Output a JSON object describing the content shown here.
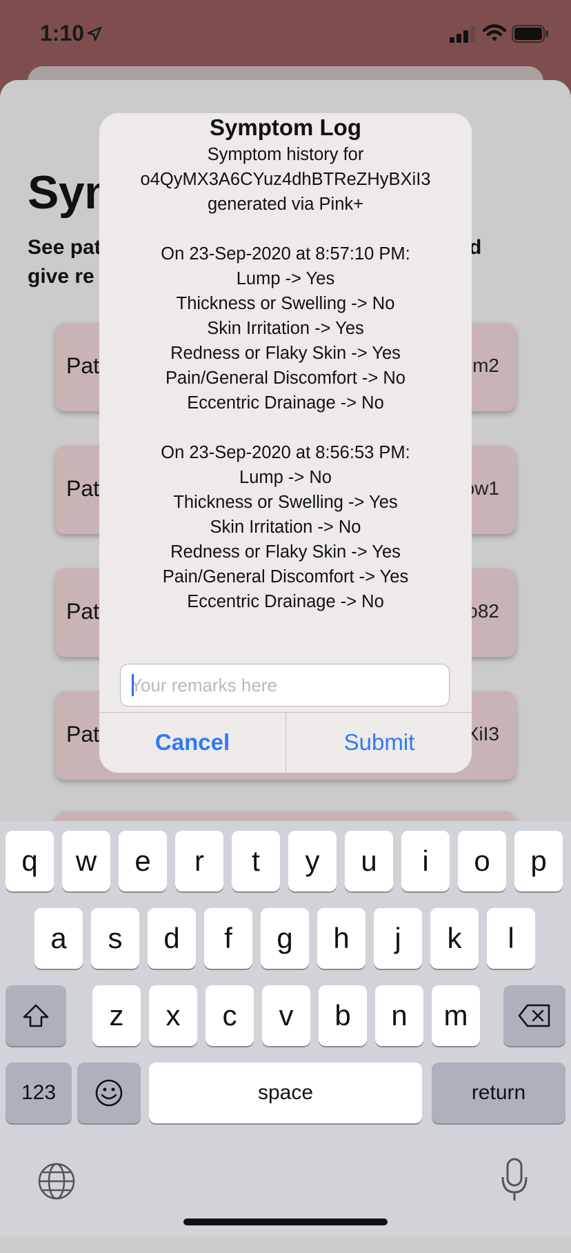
{
  "status_bar": {
    "time": "1:10"
  },
  "page": {
    "title": "Sym",
    "subtitle_line1": "See pat",
    "subtitle_line1_right": "d",
    "subtitle_line2": "give re"
  },
  "cards": [
    {
      "left": "Pat",
      "right": "m2"
    },
    {
      "left": "Pat",
      "right": "ow1"
    },
    {
      "left": "Pat",
      "right": "o82"
    },
    {
      "left": "Pat",
      "right": "XiI3"
    }
  ],
  "alert": {
    "title": "Symptom Log",
    "message_lines": [
      "Symptom history for",
      "o4QyMX3A6CYuz4dhBTReZHyBXiI3",
      "generated via Pink+",
      "",
      "On 23-Sep-2020 at 8:57:10 PM:",
      "Lump -> Yes",
      "Thickness or Swelling -> No",
      "Skin Irritation -> Yes",
      "Redness or Flaky Skin -> Yes",
      "Pain/General Discomfort -> No",
      "Eccentric Drainage -> No",
      "",
      "On 23-Sep-2020 at 8:56:53 PM:",
      "Lump -> No",
      "Thickness or Swelling -> Yes",
      "Skin Irritation -> No",
      "Redness or Flaky Skin -> Yes",
      "Pain/General Discomfort -> Yes",
      "Eccentric Drainage -> No"
    ],
    "input_placeholder": "Your remarks here",
    "input_value": "",
    "cancel_label": "Cancel",
    "submit_label": "Submit"
  },
  "keyboard": {
    "row1": [
      "q",
      "w",
      "e",
      "r",
      "t",
      "y",
      "u",
      "i",
      "o",
      "p"
    ],
    "row2": [
      "a",
      "s",
      "d",
      "f",
      "g",
      "h",
      "j",
      "k",
      "l"
    ],
    "row3": [
      "z",
      "x",
      "c",
      "v",
      "b",
      "n",
      "m"
    ],
    "numbers_label": "123",
    "space_label": "space",
    "return_label": "return"
  },
  "colors": {
    "accent": "#2f7bf0",
    "header_bg": "#7e4e4e",
    "card_bg": "#c9b3b5"
  }
}
